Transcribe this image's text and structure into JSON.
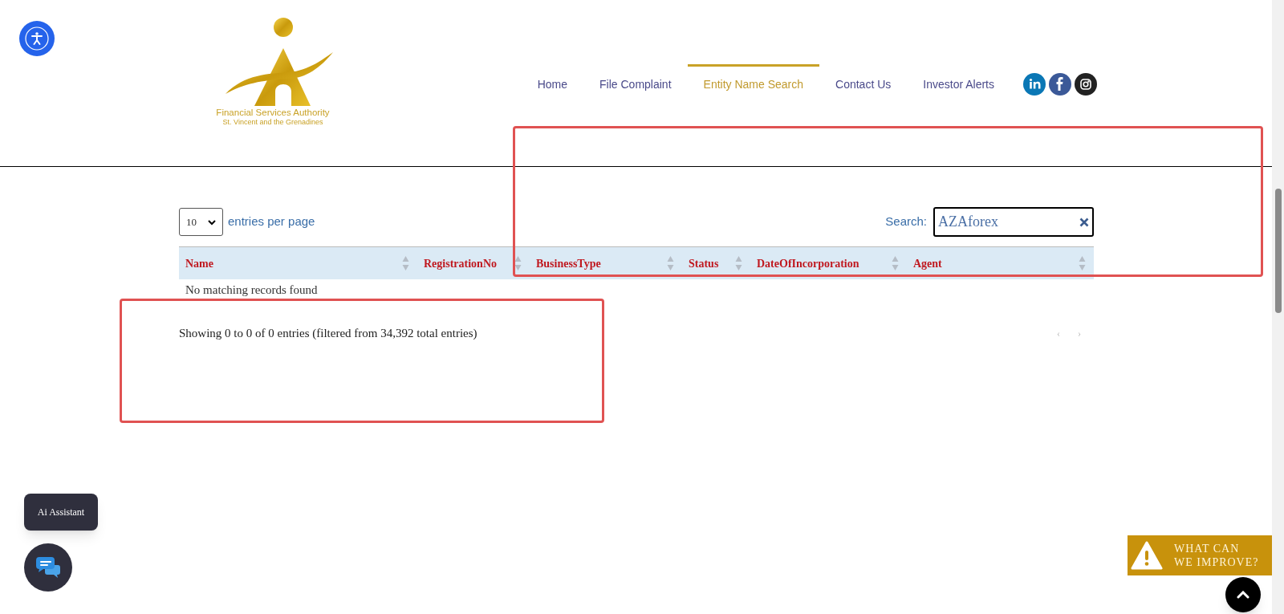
{
  "logo": {
    "title": "Financial Services Authority",
    "subtitle": "St. Vincent and the Grenadines"
  },
  "nav": [
    {
      "label": "Home",
      "selected": false
    },
    {
      "label": "File Complaint",
      "selected": false
    },
    {
      "label": "Entity Name Search",
      "selected": true
    },
    {
      "label": "Contact Us",
      "selected": false
    },
    {
      "label": "Investor Alerts",
      "selected": false
    }
  ],
  "social": [
    {
      "kind": "linkedin",
      "color": "#0a77b5"
    },
    {
      "kind": "facebook",
      "color": "#3b5998"
    },
    {
      "kind": "instagram",
      "color": "#222222"
    }
  ],
  "length_select": {
    "value": "10",
    "label": "entries per page"
  },
  "search": {
    "label": "Search:",
    "value": "AZAforex"
  },
  "table": {
    "columns": [
      "Name",
      "RegistrationNo",
      "BusinessType",
      "Status",
      "DateOfIncorporation",
      "Agent"
    ],
    "empty_message": "No matching records found"
  },
  "info": "Showing 0 to 0 of 0 entries (filtered from 34,392 total entries)",
  "pagination": {
    "previous": "‹",
    "next": "›"
  },
  "ai_assistant": "Ai Assistant",
  "feedback": {
    "line1": "WHAT CAN",
    "line2": "WE IMPROVE?"
  }
}
